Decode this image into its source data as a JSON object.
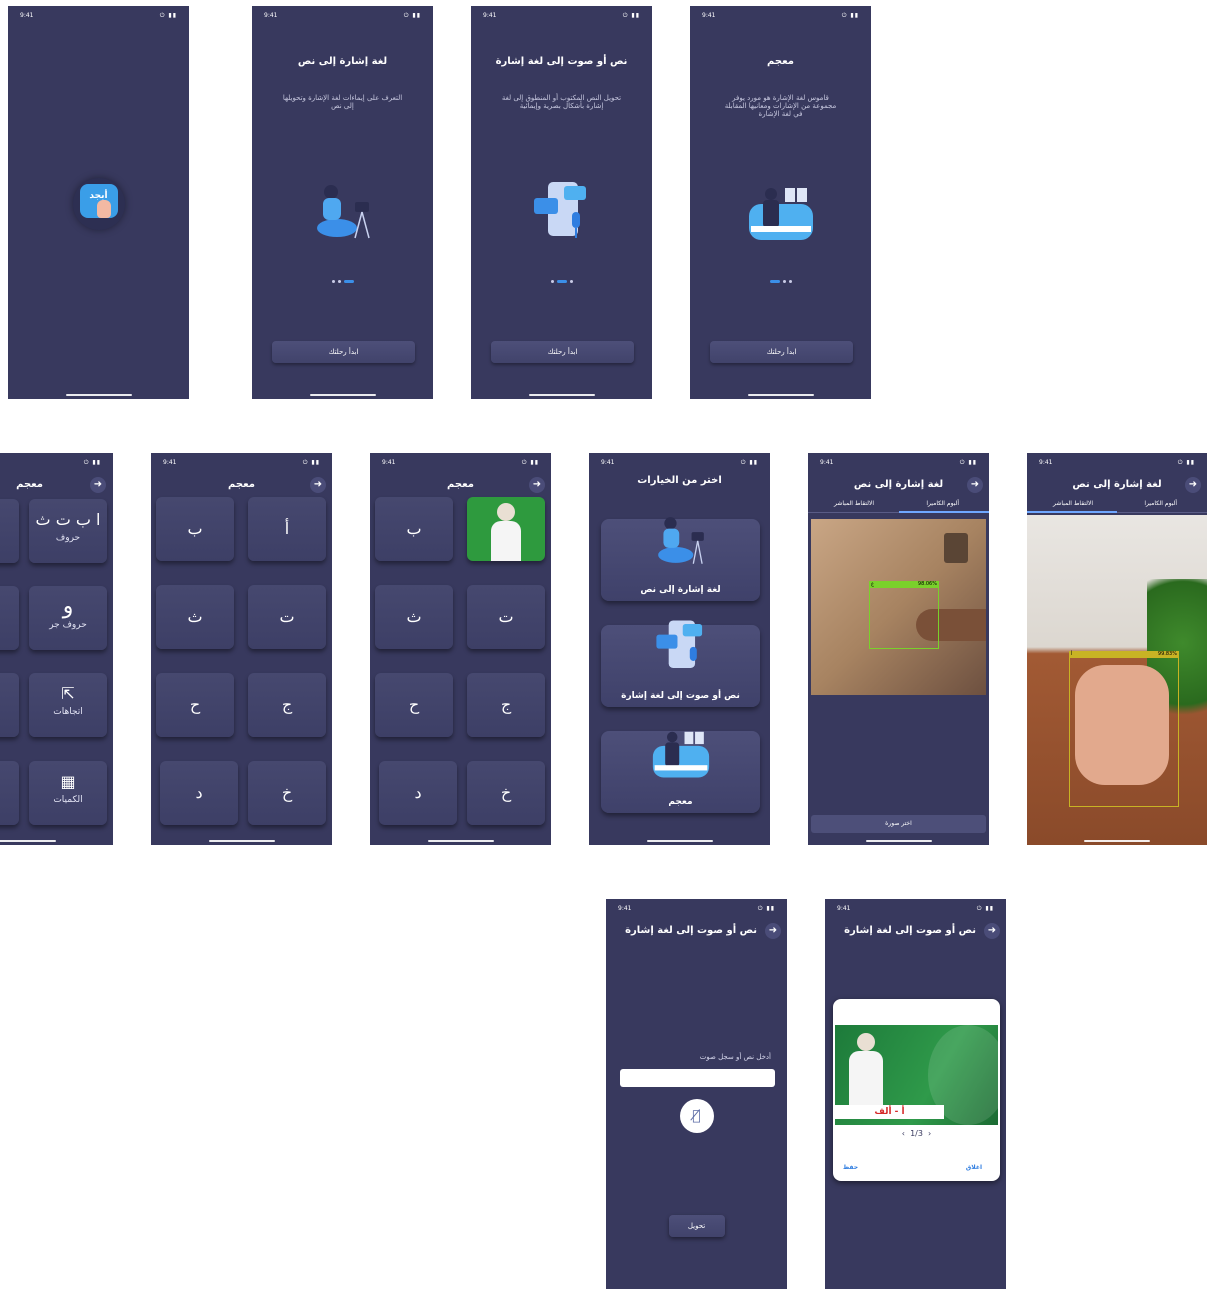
{
  "status_bar": {
    "time": "9:41",
    "icons": "⏻ ▮▮"
  },
  "splash": {
    "logo_text": "أبجد"
  },
  "onboarding": [
    {
      "title": "لغة إشارة إلى نص",
      "desc": "التعرف على إيماءات لغة الإشارة وتحويلها إلى نص",
      "button": "ابدأ رحلتك",
      "active_dot": 2
    },
    {
      "title": "نص أو صوت إلى لغة إشارة",
      "desc": "تحويل النص المكتوب أو المنطوق إلى لغة إشارة بأشكال بصرية وإيمائية",
      "button": "ابدأ رحلتك",
      "active_dot": 1
    },
    {
      "title": "معجم",
      "desc": "قاموس لغة الإشارة هو مورد يوفر مجموعة من الإشارات ومعانيها المقابلة في لغة الإشارة",
      "button": "ابدأ رحلتك",
      "active_dot": 0
    }
  ],
  "dictionary_categories": {
    "title": "معجم",
    "items": [
      {
        "icon": "ا ب ت ث",
        "label": "حروف"
      },
      {
        "icon": "و",
        "label": "حروف جر"
      },
      {
        "icon": "⇱",
        "label": "اتجاهات"
      },
      {
        "icon": "▦",
        "label": "الكميات"
      }
    ]
  },
  "letters_screen": {
    "title": "معجم",
    "letters": [
      "أ",
      "ب",
      "ت",
      "ث",
      "ج",
      "ح",
      "خ",
      "د"
    ]
  },
  "letters_screen_selected": {
    "title": "معجم",
    "letters": [
      "",
      "ب",
      "ت",
      "ث",
      "ج",
      "ح",
      "خ",
      "د"
    ]
  },
  "options_screen": {
    "title": "اختر من الخيارات",
    "options": [
      "لغة إشارة إلى نص",
      "نص أو صوت إلى لغة إشارة",
      "معجم"
    ]
  },
  "sign_to_text_gallery": {
    "title": "لغة إشارة إلى نص",
    "tab_gallery": "ألبوم الكاميرا",
    "tab_live": "الالتقاط المباشر",
    "detection_label": "ع",
    "detection_score": "98.06%",
    "button": "اختر صورة"
  },
  "sign_to_text_live": {
    "title": "لغة إشارة إلى نص",
    "tab_gallery": "ألبوم الكاميرا",
    "tab_live": "الالتقاط المباشر",
    "detection_label": "أ",
    "detection_score": "99.83%"
  },
  "text_to_sign_input": {
    "title": "نص أو صوت إلى لغة إشارة",
    "input_label": "أدخل نص أو سجل صوت",
    "input_value": "",
    "convert_button": "تحويل"
  },
  "text_to_sign_result": {
    "title": "نص أو صوت إلى لغة إشارة",
    "caption": "أ - ألف",
    "pager": "1/3",
    "save": "حفظ",
    "close": "اغلاق"
  },
  "colors": {
    "background": "#38395e",
    "accent": "#3b8fe8",
    "card": "#46486f"
  }
}
